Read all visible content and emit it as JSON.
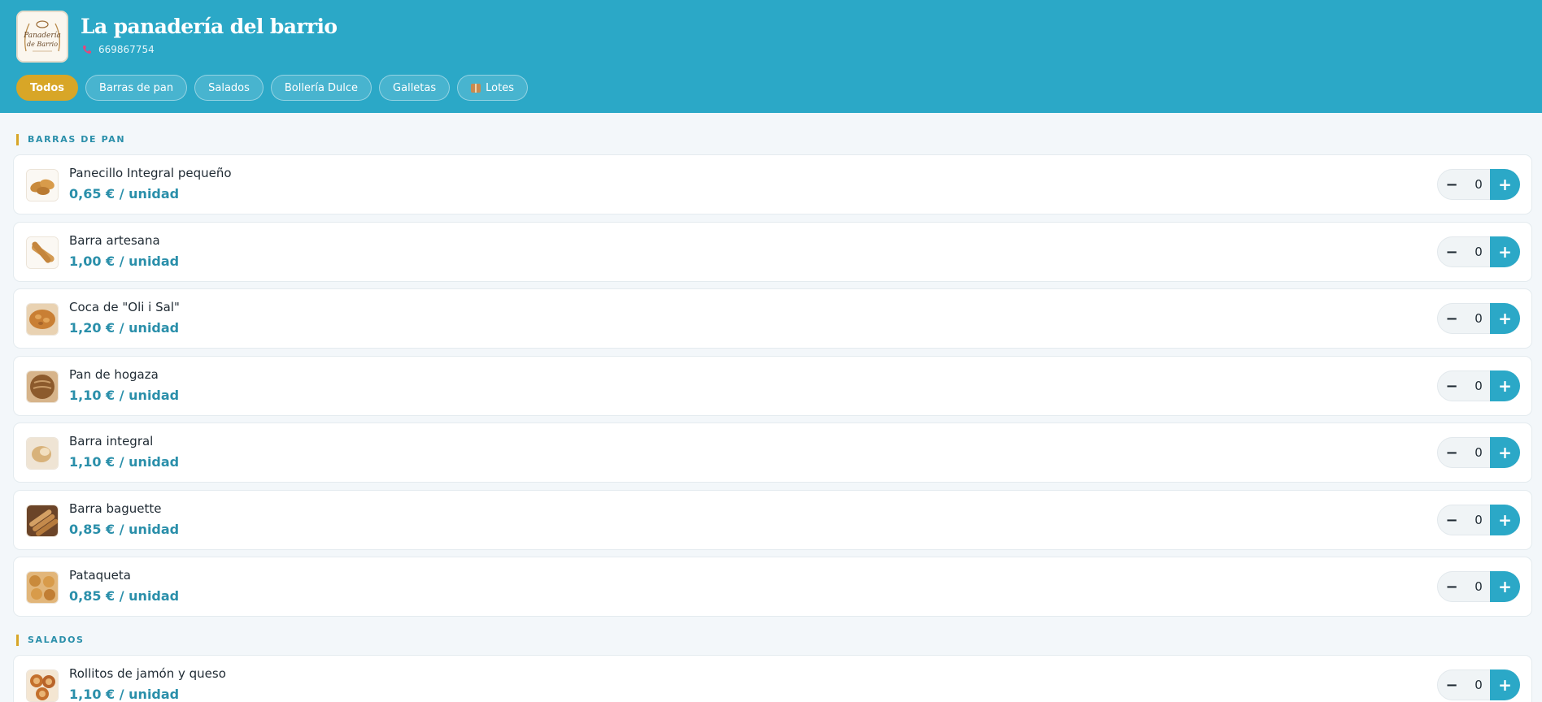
{
  "header": {
    "shop_name": "La panadería del barrio",
    "phone": "669867754",
    "logo_text": [
      "Panadería",
      "de Barrio"
    ],
    "tabs": [
      {
        "label": "Todos",
        "active": true
      },
      {
        "label": "Barras de pan",
        "active": false
      },
      {
        "label": "Salados",
        "active": false
      },
      {
        "label": "Bollería Dulce",
        "active": false
      },
      {
        "label": "Galletas",
        "active": false
      },
      {
        "label": "Lotes",
        "active": false,
        "icon": "box-icon"
      }
    ]
  },
  "colors": {
    "brand": "#2ba8c7",
    "accent": "#d8a627",
    "price": "#2a8faa"
  },
  "stepper": {
    "minus": "−",
    "plus": "+"
  },
  "sections": [
    {
      "title": "BARRAS DE PAN",
      "items": [
        {
          "name": "Panecillo Integral pequeño",
          "price": "0,65 € / unidad",
          "qty": "0"
        },
        {
          "name": "Barra artesana",
          "price": "1,00 € / unidad",
          "qty": "0"
        },
        {
          "name": "Coca de \"Oli i Sal\"",
          "price": "1,20 € / unidad",
          "qty": "0"
        },
        {
          "name": "Pan de hogaza",
          "price": "1,10 € / unidad",
          "qty": "0"
        },
        {
          "name": "Barra integral",
          "price": "1,10 € / unidad",
          "qty": "0"
        },
        {
          "name": "Barra baguette",
          "price": "0,85 € / unidad",
          "qty": "0"
        },
        {
          "name": "Pataqueta",
          "price": "0,85 € / unidad",
          "qty": "0"
        }
      ]
    },
    {
      "title": "SALADOS",
      "items": [
        {
          "name": "Rollitos de jamón y queso",
          "price": "1,10 € / unidad",
          "qty": "0"
        }
      ]
    }
  ]
}
